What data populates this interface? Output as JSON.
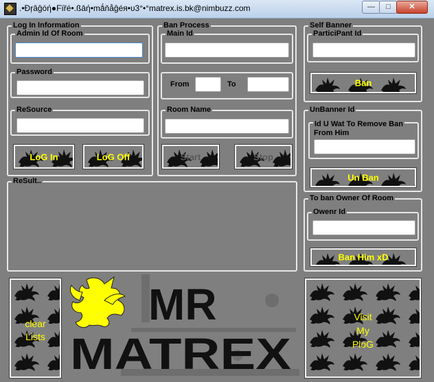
{
  "window": {
    "title": ".•Ðŗâĝóή●Fïřé•.ßāή•mǻňåĝéя•υ3°•°matrex.is.bk@nimbuzz.com",
    "controls": {
      "minimize": "—",
      "maximize": "□",
      "close": "✕"
    }
  },
  "login": {
    "group_label": "Log In Information",
    "admin_id_label": "Admin Id Of Room",
    "admin_id_value": "",
    "password_label": "Password",
    "password_value": "",
    "resource_label": "ReSource",
    "resource_value": "",
    "login_button": "LoG In",
    "logoff_button": "LoG Off"
  },
  "ban_process": {
    "group_label": "Ban Process",
    "main_id_label": "Main Id",
    "main_id_value": "",
    "from_label": "From",
    "from_value": "",
    "to_label": "To",
    "to_value": "",
    "room_name_label": "Room Name",
    "room_name_value": "",
    "start_button": "Start",
    "stop_button": "Stop"
  },
  "self_banner": {
    "group_label": "Self Banner",
    "participant_label": "ParticiPant Id",
    "participant_value": "",
    "ban_button": "Ban"
  },
  "unbanner": {
    "group_label": "UnBanner Id",
    "remove_label_line1": "Id U Wat To Remove Ban",
    "remove_label_line2": "From Him",
    "remove_value": "",
    "unban_button": "Un Ban"
  },
  "ban_owner": {
    "group_label": "To ban Owner Of Room",
    "owner_label": "Owenr Id",
    "owner_value": "",
    "ban_him_button": "Ban Him xD"
  },
  "result": {
    "group_label": "ReSult..",
    "text": ""
  },
  "bottom": {
    "clear_lists_line1": "clear",
    "clear_lists_line2": "Lists",
    "visit_line1": "Visit",
    "visit_line2": "My",
    "visit_line3": "PloG",
    "banner_word1": "MR",
    "banner_word2": "MATREX"
  },
  "colors": {
    "background": "#7f7f7f",
    "button_text": "#ffff00",
    "disabled_text": "#595959",
    "dragon_yellow": "#ffff00",
    "banner_text": "#111111"
  }
}
